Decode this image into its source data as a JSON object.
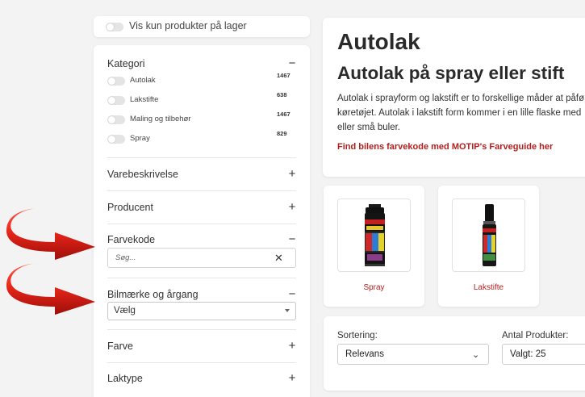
{
  "stock_filter": {
    "label": "Vis kun produkter på lager"
  },
  "filters": {
    "category": {
      "title": "Kategori",
      "toggle": "−",
      "items": [
        {
          "label": "Autolak",
          "count": "1467"
        },
        {
          "label": "Lakstifte",
          "count": "638"
        },
        {
          "label": "Maling og tilbehør",
          "count": "1467"
        },
        {
          "label": "Spray",
          "count": "829"
        }
      ]
    },
    "description": {
      "title": "Varebeskrivelse",
      "toggle": "+"
    },
    "producer": {
      "title": "Producent",
      "toggle": "+"
    },
    "color_code": {
      "title": "Farvekode",
      "toggle": "−",
      "placeholder": "Søg...",
      "clear": "✕"
    },
    "brand_year": {
      "title": "Bilmærke og årgang",
      "toggle": "−",
      "selected": "Vælg"
    },
    "color": {
      "title": "Farve",
      "toggle": "+"
    },
    "lacquer_type": {
      "title": "Laktype",
      "toggle": "+"
    }
  },
  "header": {
    "title": "Autolak",
    "subtitle": "Autolak på spray eller stift",
    "description_lines": [
      "Autolak i sprayform og lakstift er to forskellige måder at påfø",
      "køretøjet. Autolak i lakstift form kommer i en lille flaske med",
      "eller små buler."
    ],
    "link": "Find bilens farvekode med MOTIP's Farveguide her"
  },
  "products": [
    {
      "label": "Spray",
      "image": "spray-can-image"
    },
    {
      "label": "Lakstifte",
      "image": "touch-up-pen-image"
    }
  ],
  "sorting": {
    "label": "Sortering:",
    "selected": "Relevans",
    "count_label": "Antal Produkter:",
    "count_selected": "Valgt: 25"
  },
  "colors": {
    "accent": "#b41e1e",
    "arrow": "#d9221c"
  }
}
